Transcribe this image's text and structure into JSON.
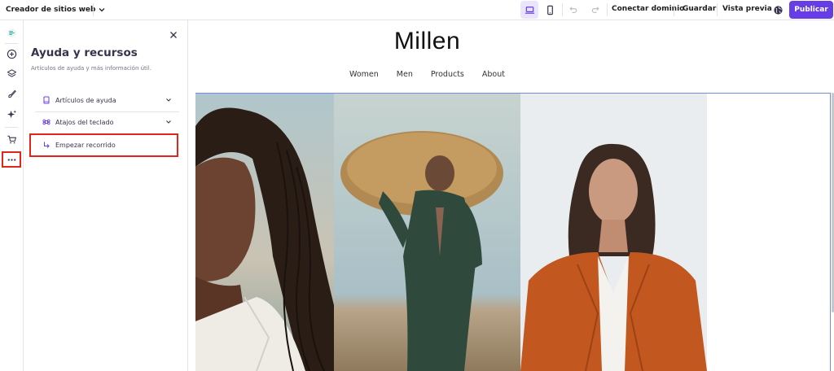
{
  "topbar": {
    "site_selector_label": "Creador de sitios web",
    "connect_domain": "Conectar dominio",
    "save": "Guardar",
    "preview": "Vista previa",
    "publish": "Publicar"
  },
  "panel": {
    "title": "Ayuda y recursos",
    "subtitle": "Artículos de ayuda y más información útil.",
    "items": [
      {
        "label": "Artículos de ayuda",
        "icon": "book-icon",
        "expandable": true
      },
      {
        "label": "Atajos del teclado",
        "icon": "command-key-icon",
        "expandable": true
      },
      {
        "label": "Empezar recorrido",
        "icon": "corner-arrow-icon",
        "expandable": false
      }
    ]
  },
  "site": {
    "brand": "Millen",
    "nav": [
      "Women",
      "Men",
      "Products",
      "About"
    ]
  },
  "colors": {
    "accent": "#673de6",
    "accent_light": "#ebe4ff",
    "highlight": "#e1251b",
    "selection": "#6f8ed6"
  }
}
